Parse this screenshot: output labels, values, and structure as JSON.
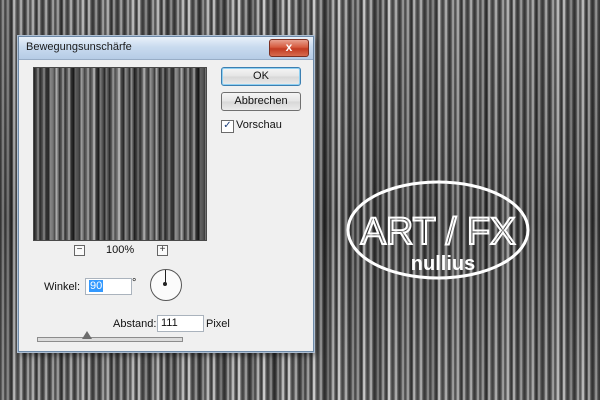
{
  "dialog": {
    "title": "Bewegungsunschärfe",
    "close_glyph": "x",
    "ok_label": "OK",
    "cancel_label": "Abbrechen",
    "preview_checkbox": {
      "label": "Vorschau",
      "checked": true,
      "check_glyph": "✓"
    },
    "zoom": {
      "value": "100%",
      "minus": "−",
      "plus": "+"
    },
    "angle": {
      "label": "Winkel:",
      "value": "90",
      "unit": "°"
    },
    "distance": {
      "label": "Abstand:",
      "value": "111",
      "unit": "Pixel"
    },
    "distance_slider_fraction": 0.35
  },
  "logo": {
    "text_top": "ART / FX",
    "text_bottom": "nullius"
  },
  "colors": {
    "accent": "#3399ff",
    "close_red": "#c23b22"
  }
}
